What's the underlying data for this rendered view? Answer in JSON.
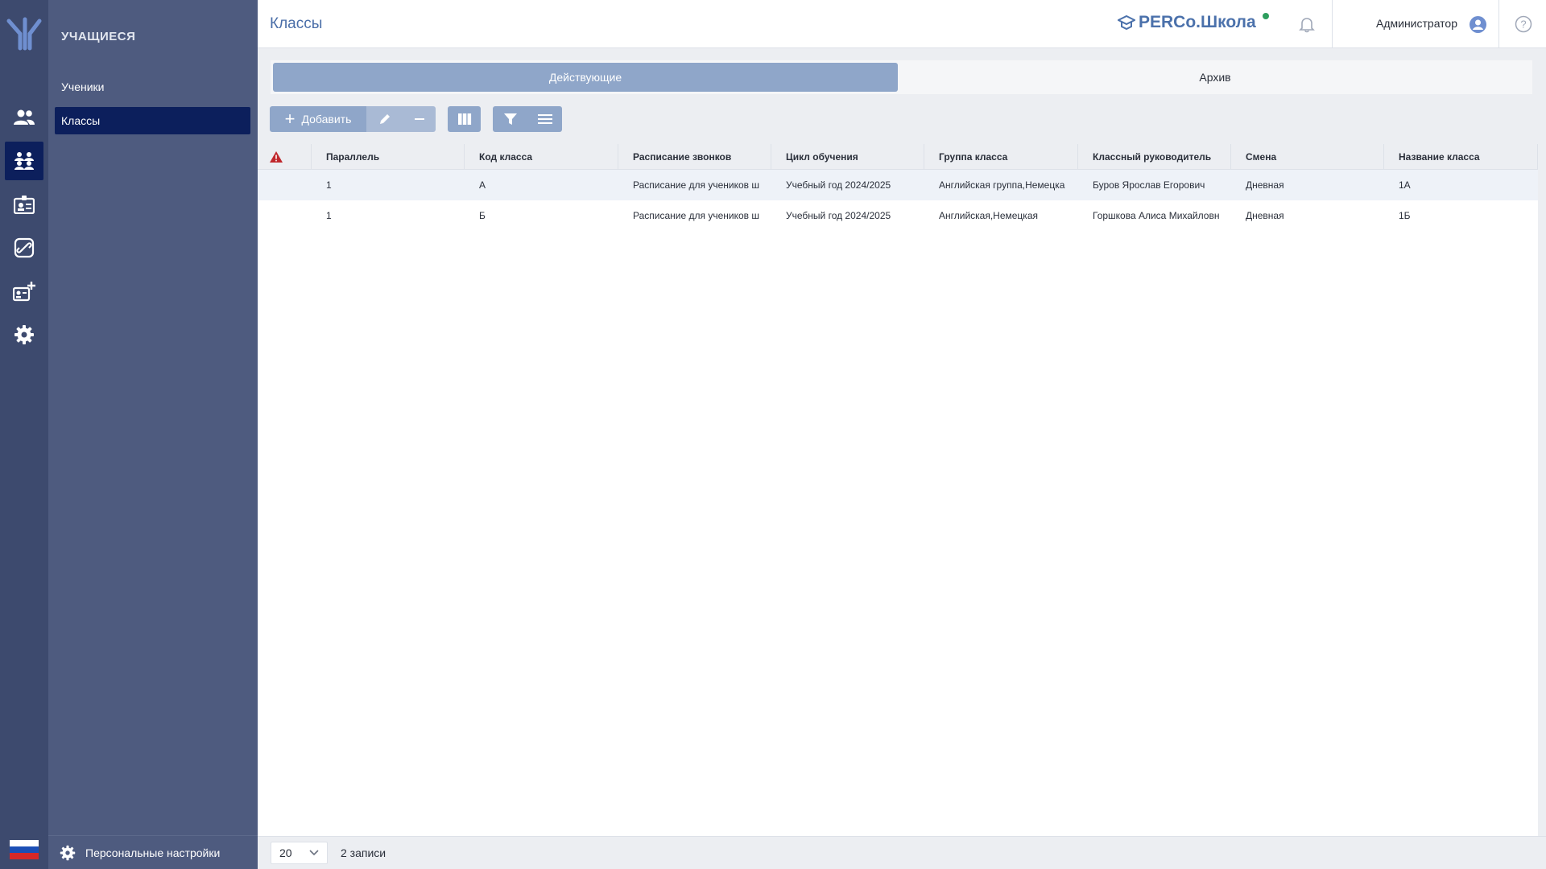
{
  "header": {
    "page_title": "Классы",
    "brand": "PERCo.Школа",
    "user": "Администратор"
  },
  "sidebar": {
    "title": "УЧАЩИЕСЯ",
    "items": [
      {
        "label": "Ученики",
        "active": false
      },
      {
        "label": "Классы",
        "active": true
      }
    ],
    "footer_label": "Персональные настройки"
  },
  "rail": {
    "icons": [
      "people-icon",
      "classes-icon",
      "badge-icon",
      "link-icon",
      "add-badge-icon",
      "gear-icon"
    ],
    "active_index": 1
  },
  "tabs": [
    {
      "label": "Действующие",
      "active": true
    },
    {
      "label": "Архив",
      "active": false
    }
  ],
  "toolbar": {
    "add_label": "Добавить"
  },
  "table": {
    "columns": [
      "Параллель",
      "Код класса",
      "Расписание звонков",
      "Цикл обучения",
      "Группа класса",
      "Классный руководитель",
      "Смена",
      "Название класса"
    ],
    "rows": [
      [
        "1",
        "А",
        "Расписание для учеников ш",
        "Учебный год 2024/2025",
        "Английская группа,Немецка",
        "Буров Ярослав Егорович",
        "Дневная",
        "1А"
      ],
      [
        "1",
        "Б",
        "Расписание для учеников ш",
        "Учебный год 2024/2025",
        "Английская,Немецкая",
        "Горшкова Алиса Михайловн",
        "Дневная",
        "1Б"
      ]
    ]
  },
  "footer": {
    "page_size": "20",
    "records": "2 записи"
  },
  "colors": {
    "rail": "#3d4a6e",
    "sidebar": "#4e5b7f",
    "active": "#0c1f5c",
    "accent": "#8fa6c9",
    "brand": "#4b71ab"
  }
}
